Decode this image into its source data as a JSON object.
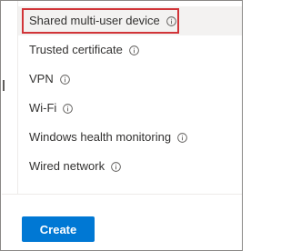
{
  "list": {
    "items": [
      {
        "label": "Shared multi-user device",
        "icon": "info-icon",
        "selected": true
      },
      {
        "label": "Trusted certificate",
        "icon": "info-icon"
      },
      {
        "label": "VPN",
        "icon": "info-icon"
      },
      {
        "label": "Wi-Fi",
        "icon": "info-icon"
      },
      {
        "label": "Windows health monitoring",
        "icon": "info-icon"
      },
      {
        "label": "Wired network",
        "icon": "info-icon"
      }
    ]
  },
  "footer": {
    "create_label": "Create"
  },
  "colors": {
    "accent": "#0078d4",
    "highlight": "#d13438",
    "selected_bg": "#f3f2f1"
  }
}
